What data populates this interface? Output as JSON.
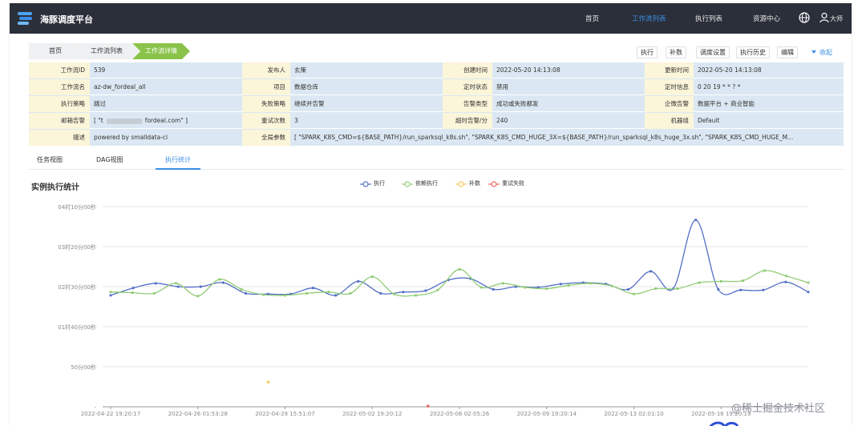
{
  "header": {
    "app_title": "海豚调度平台",
    "nav": [
      "首页",
      "工作流列表",
      "执行列表",
      "资源中心"
    ],
    "active_nav": "工作流列表",
    "user": "大师",
    "icons": [
      "logo-icon",
      "globe-icon",
      "user-icon"
    ]
  },
  "breadcrumb": [
    "首页",
    "工作流列表",
    "工作流详情"
  ],
  "actions": [
    "执行",
    "补数",
    "调度设置",
    "执行历史",
    "编辑"
  ],
  "collapse_label": "收起",
  "info": {
    "rows": [
      [
        [
          "工作流ID",
          "539"
        ],
        [
          "发布人",
          "玄策"
        ],
        [
          "创建时间",
          "2022-05-20 14:13:08"
        ],
        [
          "更新时间",
          "2022-05-20 14:13:08"
        ]
      ],
      [
        [
          "工作流名",
          "az-dw_fordeal_all"
        ],
        [
          "项目",
          "数据仓库"
        ],
        [
          "定时状态",
          "禁用"
        ],
        [
          "定时信息",
          "0 20 19 * * ? *"
        ]
      ],
      [
        [
          "执行策略",
          "跳过"
        ],
        [
          "失败策略",
          "继续并告警"
        ],
        [
          "告警类型",
          "成功或失败都发"
        ],
        [
          "企微告警",
          "数据平台 + 商业智能"
        ]
      ],
      [
        [
          "邮箱告警",
          "[ \"t"
        ],
        [
          "重试次数",
          "3"
        ],
        [
          "超时告警/分",
          "240"
        ],
        [
          "机器组",
          "Default"
        ]
      ],
      [
        [
          "描述",
          "powered by smalldata-ci"
        ],
        [
          "全局参数",
          "[ \"SPARK_K8S_CMD=${BASE_PATH}/run_sparksql_k8s.sh\", \"SPARK_K8S_CMD_HUGE_3X=${BASE_PATH}/run_sparksql_k8s_huge_3x.sh\", \"SPARK_K8S_CMD_HUGE_M..."
        ]
      ]
    ],
    "email_suffix": "fordeal.com\" ]"
  },
  "tabs": [
    "任务视图",
    "DAG视图",
    "执行统计"
  ],
  "active_tab": "执行统计",
  "section_title": "实例执行统计",
  "chart_data": {
    "type": "line",
    "title": "",
    "legend_position": "top-center",
    "legend": [
      "执行",
      "依赖执行",
      "补数",
      "重试失败"
    ],
    "y_ticks": [
      "04时10分00秒",
      "03时20分00秒",
      "02时30分00秒",
      "01时40分00秒",
      "50分00秒",
      "-"
    ],
    "y_tick_seconds": [
      15000,
      12000,
      9000,
      6000,
      3000,
      0
    ],
    "ylim": [
      0,
      15000
    ],
    "x_ticks": [
      "2022-04-22 19:20:17",
      "2022-04-26 01:53:28",
      "2022-04-29 15:51:07",
      "2022-05-02 19:20:12",
      "2022-05-06 02:05:26",
      "2022-05-09 19:20:14",
      "2022-05-13 02:01:10",
      "2022-05-16 19:20:19"
    ],
    "grid": true,
    "series": [
      {
        "name": "执行",
        "color": "#5470c6",
        "values": [
          8350,
          8900,
          9250,
          9000,
          9000,
          9300,
          8500,
          8450,
          8450,
          8900,
          8350,
          9400,
          8500,
          8600,
          8700,
          9500,
          9600,
          8800,
          9000,
          8950,
          9200,
          9300,
          9200,
          8800,
          10150,
          8850,
          14000,
          8800,
          8750,
          8750,
          9350,
          8600
        ]
      },
      {
        "name": "依赖执行",
        "color": "#91cc75",
        "values": [
          8600,
          8550,
          8500,
          9250,
          8300,
          9550,
          8800,
          8400,
          8350,
          8500,
          8600,
          8500,
          9750,
          8450,
          8350,
          8750,
          10300,
          8950,
          9250,
          8950,
          8850,
          9100,
          9250,
          9050,
          8450,
          8850,
          8850,
          9300,
          9400,
          9450,
          10200,
          9800,
          9300
        ]
      },
      {
        "name": "补数",
        "color": "#fac858",
        "points": [
          [
            7,
            1850
          ]
        ]
      },
      {
        "name": "重试失败",
        "color": "#ee6666",
        "points": [
          [
            14.1,
            50
          ]
        ]
      }
    ]
  },
  "watermark": "@稀土掘金技术社区"
}
